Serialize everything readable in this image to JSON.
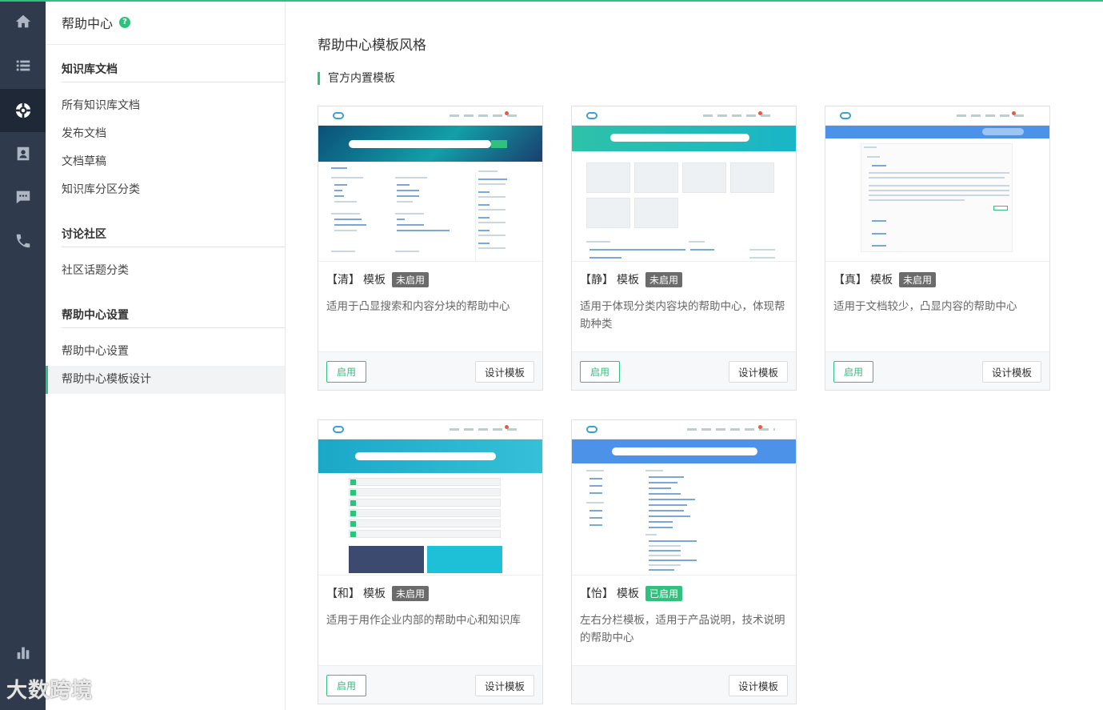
{
  "rail": {
    "items": [
      {
        "name": "home-icon"
      },
      {
        "name": "list-icon"
      },
      {
        "name": "lifebuoy-icon"
      },
      {
        "name": "contact-card-icon"
      },
      {
        "name": "chat-icon"
      },
      {
        "name": "phone-icon"
      },
      {
        "name": "bar-chart-icon"
      }
    ]
  },
  "sidebar": {
    "title": "帮助中心",
    "help_glyph": "?",
    "sections": [
      {
        "title": "知识库文档",
        "items": [
          "所有知识库文档",
          "发布文档",
          "文档草稿",
          "知识库分区分类"
        ]
      },
      {
        "title": "讨论社区",
        "items": [
          "社区话题分类"
        ]
      },
      {
        "title": "帮助中心设置",
        "items": [
          "帮助中心设置",
          "帮助中心模板设计"
        ]
      }
    ],
    "active_item": "帮助中心模板设计"
  },
  "main": {
    "title": "帮助中心模板风格",
    "section_title": "官方内置模板",
    "cards": [
      {
        "name": "【清】",
        "label": "模板",
        "status": "未启用",
        "enabled": false,
        "desc": "适用于凸显搜索和内容分块的帮助中心",
        "enable_label": "启用",
        "design_label": "设计模板"
      },
      {
        "name": "【静】",
        "label": "模板",
        "status": "未启用",
        "enabled": false,
        "desc": "适用于体现分类内容块的帮助中心，体现帮助种类",
        "enable_label": "启用",
        "design_label": "设计模板"
      },
      {
        "name": "【真】",
        "label": "模板",
        "status": "未启用",
        "enabled": false,
        "desc": "适用于文档较少，凸显内容的帮助中心",
        "enable_label": "启用",
        "design_label": "设计模板"
      },
      {
        "name": "【和】",
        "label": "模板",
        "status": "未启用",
        "enabled": false,
        "desc": "适用于用作企业内部的帮助中心和知识库",
        "enable_label": "启用",
        "design_label": "设计模板"
      },
      {
        "name": "【怡】",
        "label": "模板",
        "status": "已启用",
        "enabled": true,
        "desc": "左右分栏模板，适用于产品说明，技术说明的帮助中心",
        "enable_label": "",
        "design_label": "设计模板"
      }
    ]
  },
  "watermark": "大数跨境",
  "colors": {
    "accent": "#2ec27e",
    "rail_bg": "#2f3a4c",
    "badge_off": "#6b6b6b"
  }
}
